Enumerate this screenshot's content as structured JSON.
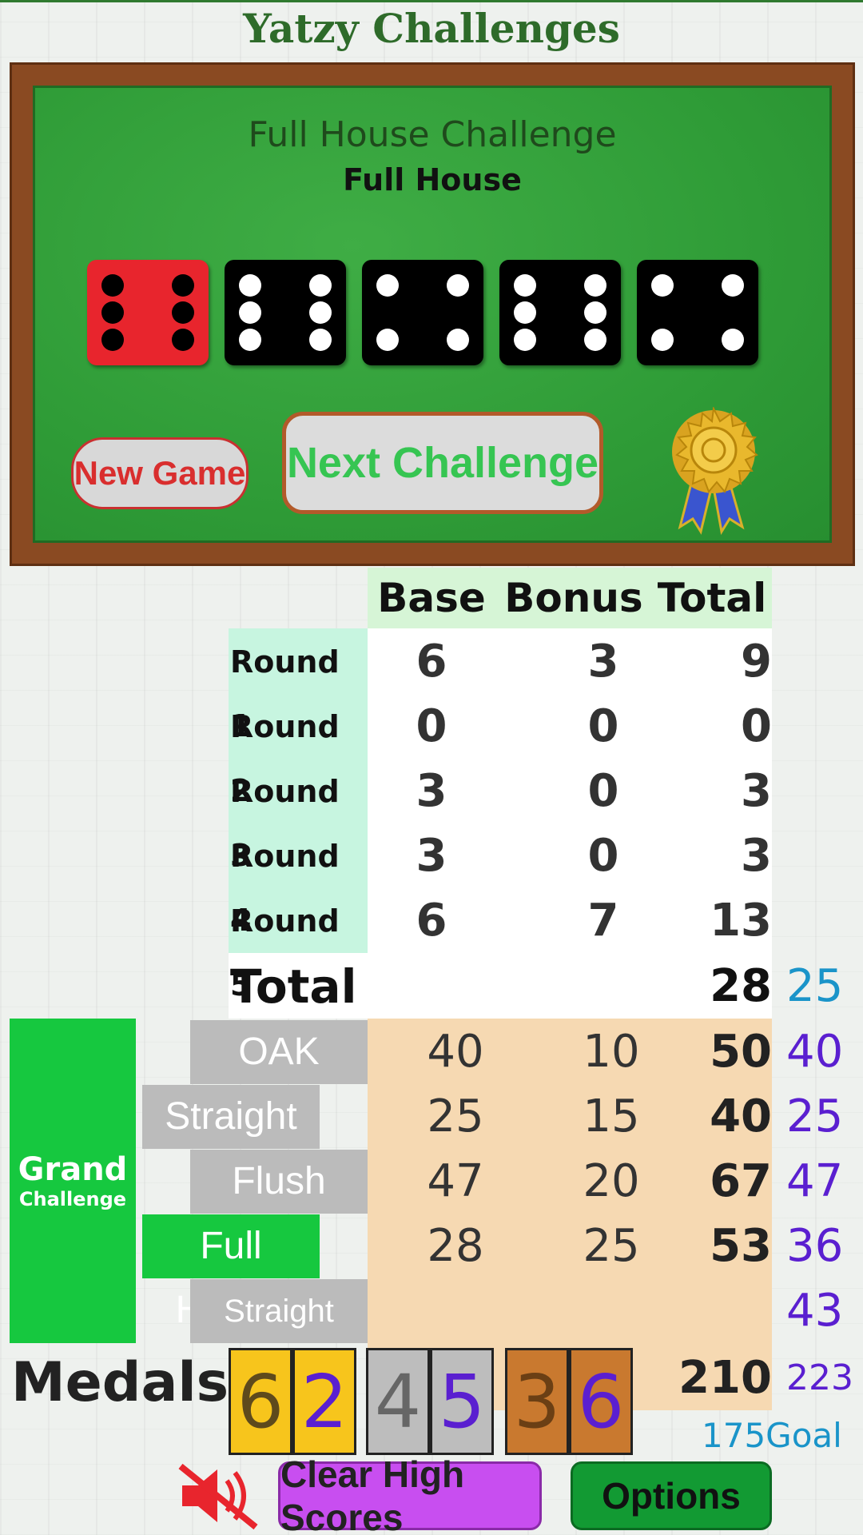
{
  "app_title": "Yatzy Challenges",
  "board": {
    "challenge_title": "Full House Challenge",
    "challenge_category": "Full House",
    "dice": [
      {
        "value": 6,
        "held": true
      },
      {
        "value": 6,
        "held": false
      },
      {
        "value": 4,
        "held": false
      },
      {
        "value": 6,
        "held": false
      },
      {
        "value": 4,
        "held": false
      }
    ],
    "new_game_label": "New Game",
    "next_challenge_label": "Next Challenge"
  },
  "table": {
    "headers": [
      "Base",
      "Bonus",
      "Total"
    ],
    "rounds": [
      {
        "label": "Round 1",
        "base": "6",
        "bonus": "3",
        "total": "9"
      },
      {
        "label": "Round 2",
        "base": "0",
        "bonus": "0",
        "total": "0"
      },
      {
        "label": "Round 3",
        "base": "3",
        "bonus": "0",
        "total": "3"
      },
      {
        "label": "Round 4",
        "base": "3",
        "bonus": "0",
        "total": "3"
      },
      {
        "label": "Round 5",
        "base": "6",
        "bonus": "7",
        "total": "13"
      }
    ],
    "total_label": "Total",
    "total_value": "28",
    "total_side": "25"
  },
  "grand": {
    "label_line1": "Grand",
    "label_line2": "Challenge",
    "categories": [
      {
        "label": "OAK",
        "base": "40",
        "bonus": "10",
        "total": "50",
        "side": "40"
      },
      {
        "label": "Straight",
        "base": "25",
        "bonus": "15",
        "total": "40",
        "side": "25"
      },
      {
        "label": "Flush",
        "base": "47",
        "bonus": "20",
        "total": "67",
        "side": "47"
      },
      {
        "label": "Full House",
        "base": "28",
        "bonus": "25",
        "total": "53",
        "side": "36"
      },
      {
        "label": "Straight Flush",
        "base": "",
        "bonus": "",
        "total": "",
        "side": "43"
      }
    ],
    "grand_total": "210",
    "grand_side": "223",
    "goal_value": "175",
    "goal_label": "Goal"
  },
  "medals": {
    "label": "Medals",
    "gold": [
      "6",
      "2"
    ],
    "silver": [
      "4",
      "5"
    ],
    "bronze": [
      "3",
      "6"
    ]
  },
  "footer": {
    "mute_icon": "mute-speaker-icon",
    "clear_label": "Clear High Scores",
    "options_label": "Options"
  },
  "colors": {
    "felt_green": "#2f9c37",
    "frame_brown": "#8a4a22",
    "header_green": "#d6f5d6",
    "round_label_bg": "#c7f5e0",
    "grand_bg": "#f6d9b2",
    "grand_label_green": "#16c83f",
    "side_purple": "#5a1fd0",
    "side_blue": "#1a94c9"
  }
}
